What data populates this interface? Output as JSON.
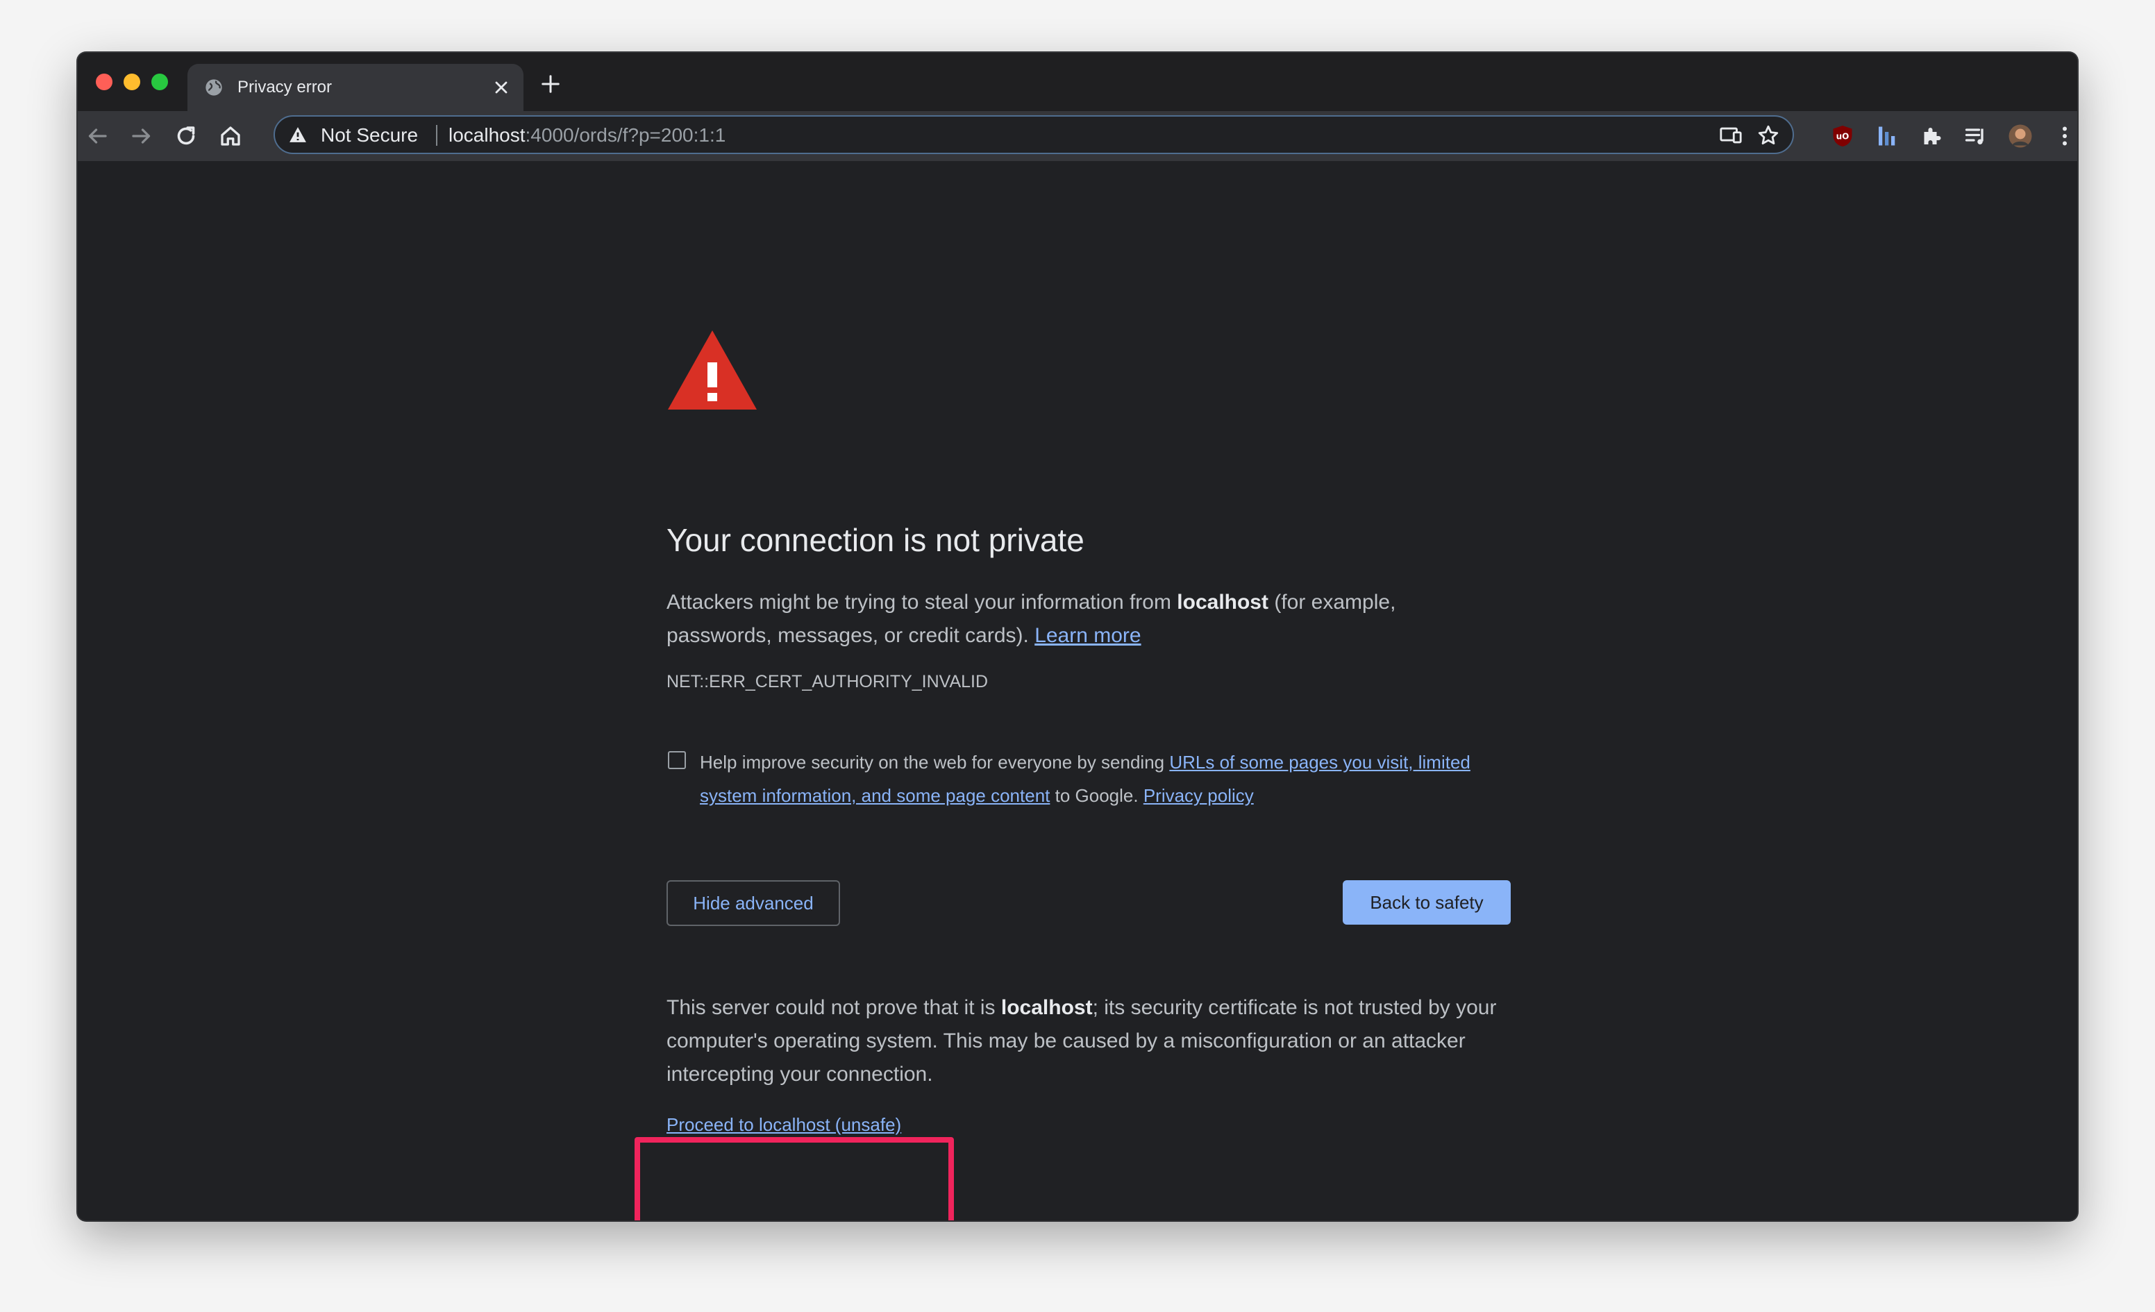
{
  "window": {
    "tab": {
      "title": "Privacy error",
      "close": "×",
      "new_tab": "+"
    }
  },
  "omnibox": {
    "security_label": "Not Secure",
    "url_host": "localhost",
    "url_rest": ":4000/ords/f?p=200:1:1"
  },
  "toolbar": {
    "icons": [
      "back-arrow-icon",
      "forward-arrow-icon",
      "reload-icon",
      "home-icon",
      "cast-icon",
      "star-icon",
      "ublock-icon",
      "extension-bars-icon",
      "puzzle-extensions-icon",
      "reading-list-icon",
      "profile-avatar",
      "kebab-menu-icon"
    ]
  },
  "interstitial": {
    "heading": "Your connection is not private",
    "intro_before": "Attackers might be trying to steal your information from ",
    "host": "localhost",
    "intro_after": " (for example, passwords, messages, or credit cards). ",
    "learn_more": "Learn more",
    "error_code": "NET::ERR_CERT_AUTHORITY_INVALID",
    "checkbox_before": "Help improve security on the web for everyone by sending ",
    "checkbox_link": "URLs of some pages you visit, limited system information, and some page content",
    "checkbox_middle": " to Google. ",
    "privacy_policy": "Privacy policy",
    "hide_advanced": "Hide advanced",
    "back_to_safety": "Back to safety",
    "details_before": "This server could not prove that it is ",
    "details_host": "localhost",
    "details_after": "; its security certificate is not trusted by your computer's operating system. This may be caused by a misconfiguration or an attacker intercepting your connection.",
    "proceed": "Proceed to localhost (unsafe)"
  },
  "colors": {
    "page_bg": "#202124",
    "link": "#8ab4f8",
    "warning_red": "#d93025",
    "highlight_box": "#f0245c"
  }
}
